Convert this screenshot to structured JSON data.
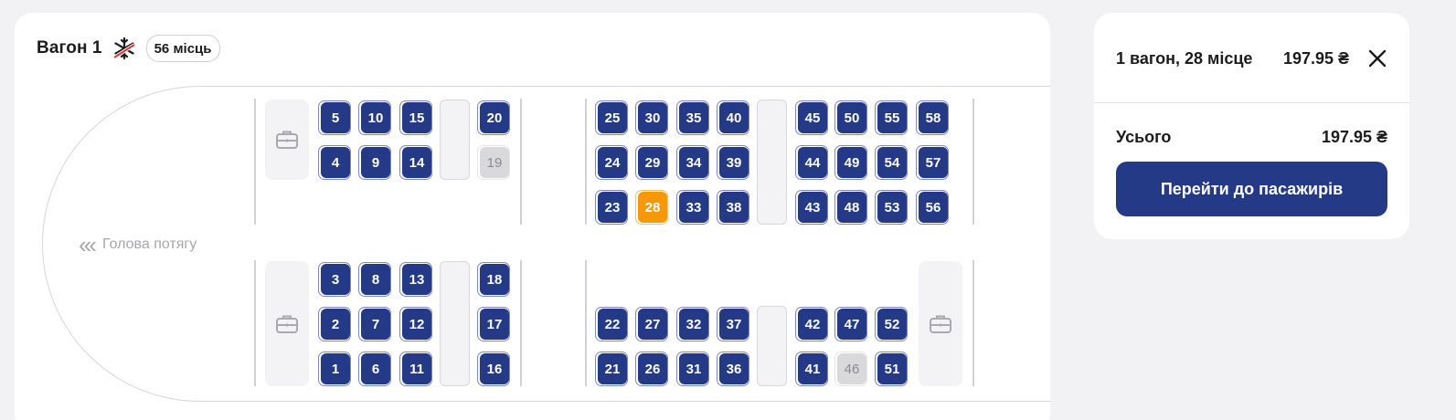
{
  "car": {
    "title": "Вагон 1",
    "seats_badge": "56 місць",
    "head_label": "Голова потягу"
  },
  "icons": {
    "no_ac": "snowflake-crossed-icon",
    "luggage": "suitcase-icon",
    "close": "close-icon",
    "direction": "chevrons-left-icon"
  },
  "colors": {
    "seat_free": "#243a86",
    "seat_selected": "#f5990b",
    "seat_occupied": "#d9d9dc"
  },
  "seats": [
    {
      "n": "5",
      "state": "free"
    },
    {
      "n": "10",
      "state": "free"
    },
    {
      "n": "15",
      "state": "free"
    },
    {
      "n": "20",
      "state": "free"
    },
    {
      "n": "4",
      "state": "free"
    },
    {
      "n": "9",
      "state": "free"
    },
    {
      "n": "14",
      "state": "free"
    },
    {
      "n": "19",
      "state": "occupied"
    },
    {
      "n": "3",
      "state": "free"
    },
    {
      "n": "8",
      "state": "free"
    },
    {
      "n": "13",
      "state": "free"
    },
    {
      "n": "18",
      "state": "free"
    },
    {
      "n": "2",
      "state": "free"
    },
    {
      "n": "7",
      "state": "free"
    },
    {
      "n": "12",
      "state": "free"
    },
    {
      "n": "17",
      "state": "free"
    },
    {
      "n": "1",
      "state": "free"
    },
    {
      "n": "6",
      "state": "free"
    },
    {
      "n": "11",
      "state": "free"
    },
    {
      "n": "16",
      "state": "free"
    },
    {
      "n": "25",
      "state": "free"
    },
    {
      "n": "30",
      "state": "free"
    },
    {
      "n": "35",
      "state": "free"
    },
    {
      "n": "40",
      "state": "free"
    },
    {
      "n": "24",
      "state": "free"
    },
    {
      "n": "29",
      "state": "free"
    },
    {
      "n": "34",
      "state": "free"
    },
    {
      "n": "39",
      "state": "free"
    },
    {
      "n": "23",
      "state": "free"
    },
    {
      "n": "28",
      "state": "selected"
    },
    {
      "n": "33",
      "state": "free"
    },
    {
      "n": "38",
      "state": "free"
    },
    {
      "n": "22",
      "state": "free"
    },
    {
      "n": "27",
      "state": "free"
    },
    {
      "n": "32",
      "state": "free"
    },
    {
      "n": "37",
      "state": "free"
    },
    {
      "n": "21",
      "state": "free"
    },
    {
      "n": "26",
      "state": "free"
    },
    {
      "n": "31",
      "state": "free"
    },
    {
      "n": "36",
      "state": "free"
    },
    {
      "n": "45",
      "state": "free"
    },
    {
      "n": "50",
      "state": "free"
    },
    {
      "n": "55",
      "state": "free"
    },
    {
      "n": "58",
      "state": "free"
    },
    {
      "n": "44",
      "state": "free"
    },
    {
      "n": "49",
      "state": "free"
    },
    {
      "n": "54",
      "state": "free"
    },
    {
      "n": "57",
      "state": "free"
    },
    {
      "n": "43",
      "state": "free"
    },
    {
      "n": "48",
      "state": "free"
    },
    {
      "n": "53",
      "state": "free"
    },
    {
      "n": "56",
      "state": "free"
    },
    {
      "n": "42",
      "state": "free"
    },
    {
      "n": "47",
      "state": "free"
    },
    {
      "n": "52",
      "state": "free"
    },
    {
      "n": "41",
      "state": "free"
    },
    {
      "n": "46",
      "state": "occupied"
    },
    {
      "n": "51",
      "state": "free"
    }
  ],
  "summary": {
    "selection_label": "1 вагон, 28 місце",
    "selection_price": "197.95 ₴",
    "total_label": "Усього",
    "total_price": "197.95 ₴",
    "cta_label": "Перейти до пасажирів"
  }
}
